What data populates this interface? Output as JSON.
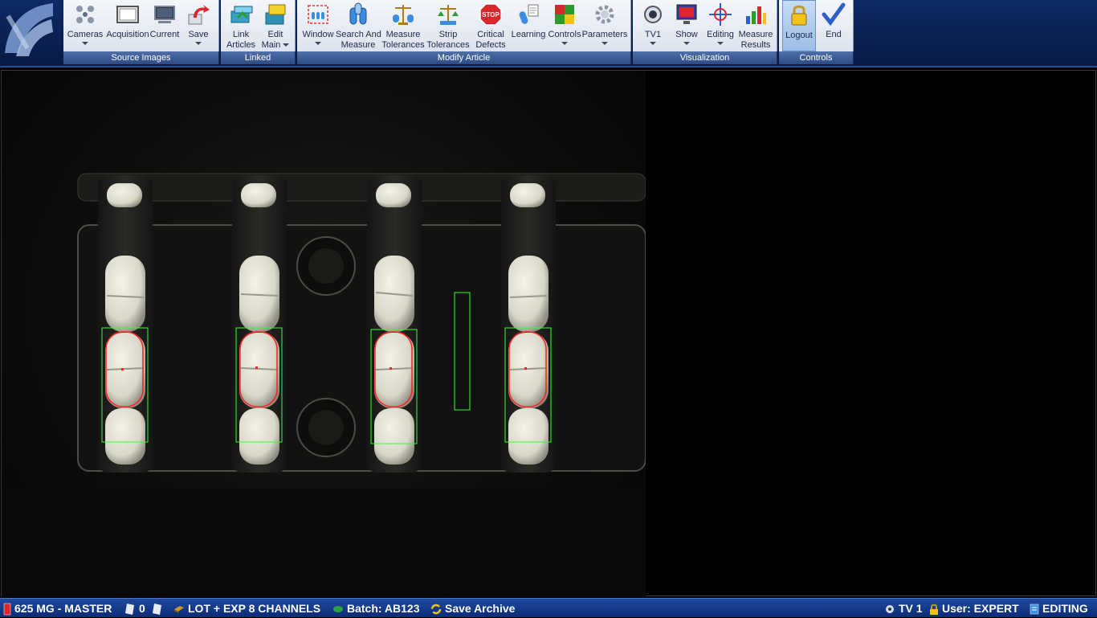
{
  "ribbon": {
    "groups": {
      "source_images": "Source Images",
      "linked": "Linked",
      "modify_article": "Modify Article",
      "visualization": "Visualization",
      "controls": "Controls"
    },
    "buttons": {
      "cameras": "Cameras",
      "acquisition": "Acquisition",
      "current": "Current",
      "save": "Save",
      "link_articles_1": "Link",
      "link_articles_2": "Articles",
      "edit_main_1": "Edit",
      "edit_main_2": "Main",
      "window": "Window",
      "search_measure_1": "Search And",
      "search_measure_2": "Measure",
      "measure_tol_1": "Measure",
      "measure_tol_2": "Tolerances",
      "strip_tol_1": "Strip",
      "strip_tol_2": "Tolerances",
      "critical_1": "Critical",
      "critical_2": "Defects",
      "learning": "Learning",
      "controls": "Controls",
      "parameters": "Parameters",
      "tv1": "TV1",
      "show": "Show",
      "editing": "Editing",
      "measure_res_1": "Measure",
      "measure_res_2": "Results",
      "logout": "Logout",
      "end": "End"
    },
    "stop_text": "STOP"
  },
  "status": {
    "article": "625 MG - MASTER",
    "count": "0",
    "lot": "LOT + EXP 8 CHANNELS",
    "batch": "Batch: AB123",
    "archive": "Save Archive",
    "tv": "TV 1",
    "user": "User: EXPERT",
    "mode": "EDITING"
  },
  "colors": {
    "ribbon_bg": "#0a2356",
    "status_bg": "#1a44a0",
    "roi_green": "#33ff33",
    "contour_red": "#ff2020"
  }
}
